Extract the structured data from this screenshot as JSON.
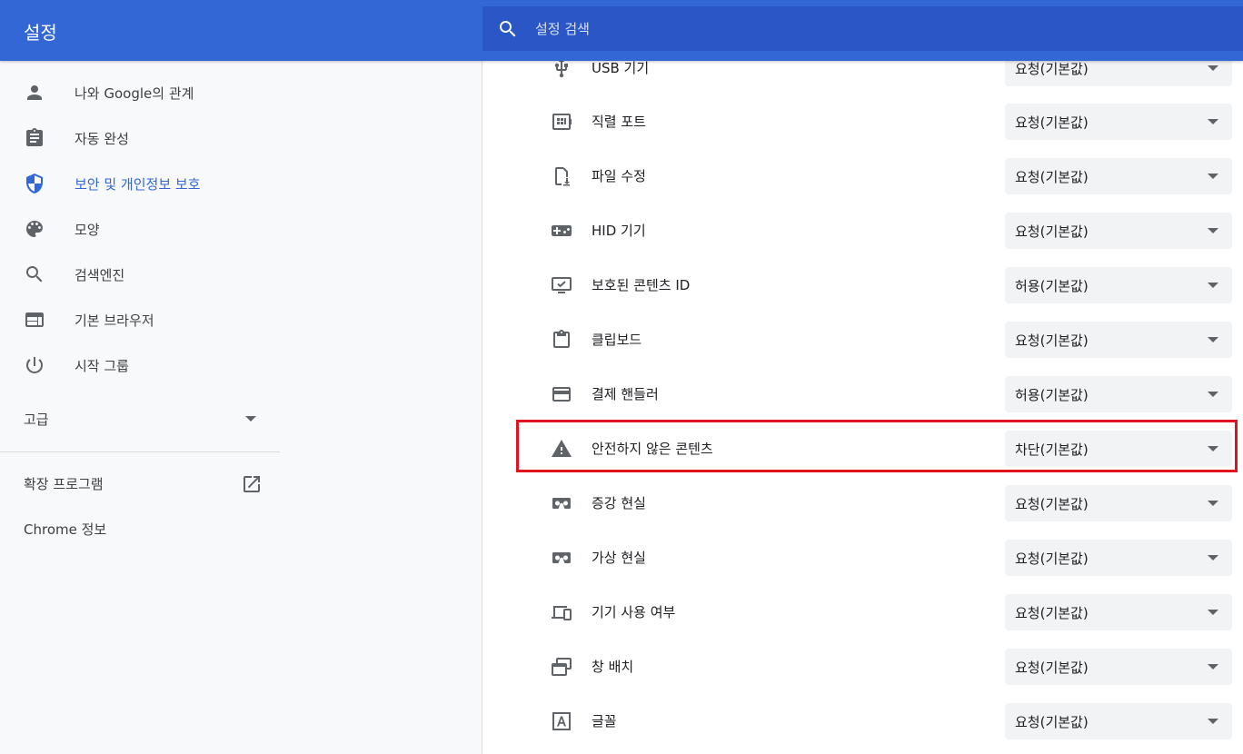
{
  "header": {
    "title": "설정",
    "search_placeholder": "설정 검색"
  },
  "sidebar": {
    "items": [
      {
        "label": "나와 Google의 관계",
        "icon": "person-icon"
      },
      {
        "label": "자동 완성",
        "icon": "clipboard-icon"
      },
      {
        "label": "보안 및 개인정보 보호",
        "icon": "shield-icon",
        "active": true
      },
      {
        "label": "모양",
        "icon": "palette-icon"
      },
      {
        "label": "검색엔진",
        "icon": "search-icon"
      },
      {
        "label": "기본 브라우저",
        "icon": "browser-window-icon"
      },
      {
        "label": "시작 그룹",
        "icon": "power-icon"
      }
    ],
    "advanced_label": "고급",
    "extensions_label": "확장 프로그램",
    "about_label": "Chrome 정보"
  },
  "permissions": [
    {
      "label": "USB 기기",
      "value": "요청(기본값)",
      "icon": "usb-icon"
    },
    {
      "label": "직렬 포트",
      "value": "요청(기본값)",
      "icon": "serial-port-icon"
    },
    {
      "label": "파일 수정",
      "value": "요청(기본값)",
      "icon": "file-save-icon"
    },
    {
      "label": "HID 기기",
      "value": "요청(기본값)",
      "icon": "gamepad-icon"
    },
    {
      "label": "보호된 콘텐츠 ID",
      "value": "허용(기본값)",
      "icon": "protected-content-icon"
    },
    {
      "label": "클립보드",
      "value": "요청(기본값)",
      "icon": "clipboard-icon"
    },
    {
      "label": "결제 핸들러",
      "value": "허용(기본값)",
      "icon": "credit-card-icon"
    },
    {
      "label": "안전하지 않은 콘텐츠",
      "value": "차단(기본값)",
      "icon": "warning-icon",
      "highlighted": true
    },
    {
      "label": "증강 현실",
      "value": "요청(기본값)",
      "icon": "vr-headset-icon"
    },
    {
      "label": "가상 현실",
      "value": "요청(기본값)",
      "icon": "vr-headset-icon"
    },
    {
      "label": "기기 사용 여부",
      "value": "요청(기본값)",
      "icon": "devices-icon"
    },
    {
      "label": "창 배치",
      "value": "요청(기본값)",
      "icon": "window-placement-icon"
    },
    {
      "label": "글꼴",
      "value": "요청(기본값)",
      "icon": "font-icon"
    }
  ],
  "colors": {
    "header": "#3367d6",
    "search_bar": "#2a56c6",
    "active_nav": "#3367d6",
    "highlight_border": "#e0141e",
    "dropdown_bg": "#f1f3f4"
  }
}
